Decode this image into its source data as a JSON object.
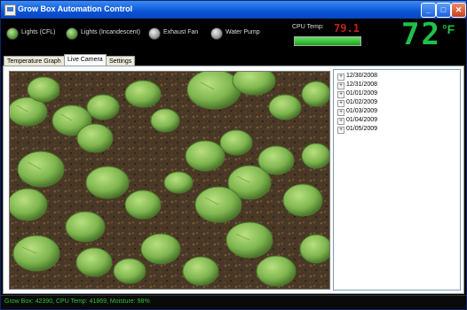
{
  "window": {
    "title": "Grow Box Automation Control",
    "minimize_label": "_",
    "maximize_label": "□",
    "close_label": "✕"
  },
  "indicators": [
    {
      "label": "Lights (CFL)",
      "state": "on"
    },
    {
      "label": "Lights (Incandescent)",
      "state": "on"
    },
    {
      "label": "Exhaust Fan",
      "state": "off"
    },
    {
      "label": "Water Pump",
      "state": "off"
    }
  ],
  "cpu": {
    "label": "CPU Temp:",
    "value": "79.1",
    "bar_percent": 100,
    "value_color": "#c41e1e",
    "bar_color": "#3fcf3f"
  },
  "temperature": {
    "value": "72",
    "unit": "°F",
    "color": "#1fbf4f"
  },
  "tabs": [
    {
      "label": "Temperature Graph",
      "active": false
    },
    {
      "label": "Live Camera",
      "active": true
    },
    {
      "label": "Settings",
      "active": false
    }
  ],
  "dates": [
    "12/30/2008",
    "12/31/2008",
    "01/01/2009",
    "01/02/2009",
    "01/03/2009",
    "01/04/2009",
    "01/05/2009"
  ],
  "expander_glyph": "+",
  "status": {
    "text": "Grow Box: 42390, CPU Temp: 41869, Moisture: 98%",
    "color": "#34c034"
  },
  "icons": {
    "app": "app-window-icon",
    "tree_expander": "plus-expander-icon"
  }
}
